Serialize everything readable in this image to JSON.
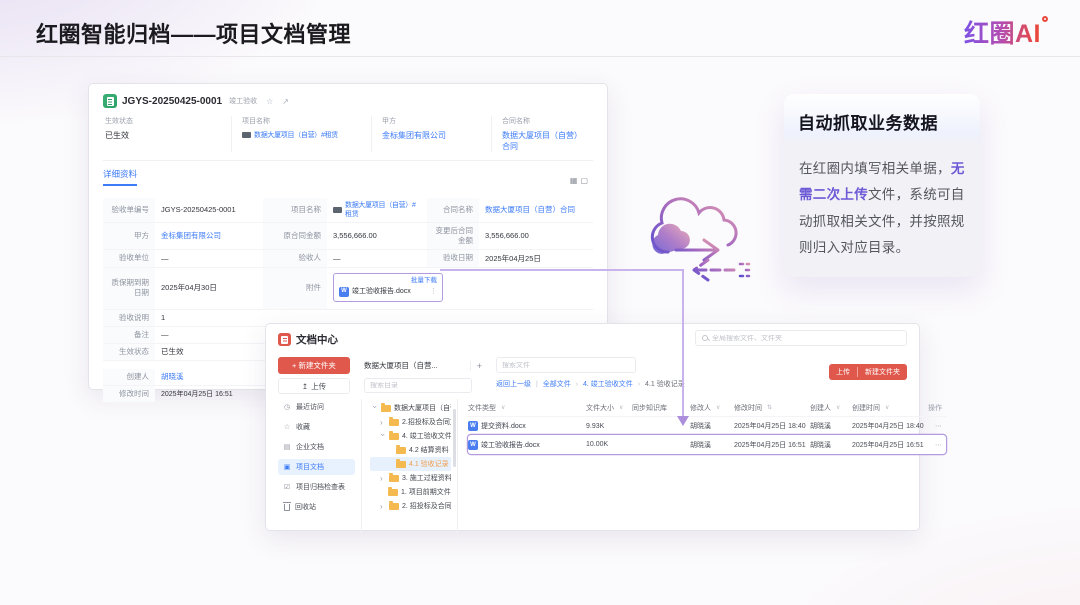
{
  "slide": {
    "title": "红圈智能归档——项目文档管理",
    "logo": "红圈AI"
  },
  "icons": {
    "star": "☆",
    "external": "↗",
    "grid_filled": "▦",
    "grid_empty": "▢",
    "caret": "∨",
    "sort": "⇅",
    "kebab": "⋮",
    "more": "⋯",
    "plus": "+",
    "upload": "↥",
    "chevron": "›",
    "clock": "◷",
    "fav": "☆",
    "corp": "▤",
    "proj": "▣",
    "check": "☑",
    "word": "W",
    "pipe": "|",
    "new_folder_plus": "+"
  },
  "detail_window": {
    "doc_id": "JGYS-20250425-0001",
    "doc_type": "竣工验收",
    "summary": [
      {
        "label": "生效状态",
        "value": "已生效"
      },
      {
        "label": "项目名称",
        "value": "数据大厦项目（自营）#租赁"
      },
      {
        "label": "甲方",
        "value": "金标集团有限公司"
      },
      {
        "label": "合同名称",
        "value": "数据大厦项目（自营）合同"
      }
    ],
    "tab": "详细资料",
    "rows": {
      "r1": {
        "l1": "验收单编号",
        "v1": "JGYS-20250425-0001",
        "l2": "项目名称",
        "v2": "数据大厦项目（自营）#租赁",
        "l3": "合同名称",
        "v3": "数据大厦项目（自营）合同"
      },
      "r2": {
        "l1": "甲方",
        "v1": "金标集团有限公司",
        "l2": "原合同金额",
        "v2": "3,556,666.00",
        "l3": "变更后合同金额",
        "v3": "3,556,666.00"
      },
      "r3": {
        "l1": "验收单位",
        "v1": "—",
        "l2": "验收人",
        "v2": "—",
        "l3": "验收日期",
        "v3": "2025年04月25日"
      },
      "r4": {
        "l1": "质保期到期日期",
        "v1": "2025年04月30日",
        "l2": "附件"
      },
      "r5": {
        "l1": "验收说明",
        "v1": "1"
      },
      "r6": {
        "l1": "备注",
        "v1": "—"
      },
      "r7": {
        "l1": "生效状态",
        "v1": "已生效"
      },
      "r8": {
        "l1": "创建人",
        "v1": "胡晓溪"
      },
      "r9": {
        "l1": "修改时间",
        "v1": "2025年04月25日 16:51"
      }
    },
    "attachment": {
      "download": "批量下载",
      "filename": "竣工验收报告.docx"
    }
  },
  "doc_center": {
    "title": "文档中心",
    "global_search_placeholder": "全局搜索文件、文件夹",
    "new_folder_button": "新建文件夹",
    "upload_button": "上传",
    "project_selector": "数据大厦项目（自营...",
    "search_file_placeholder": "搜索文件",
    "search_dir_placeholder": "搜索目录",
    "breadcrumb": [
      "返回上一级",
      "全部文件",
      "4. 竣工验收文件",
      "4.1 验收记录"
    ],
    "topright_upload": "上传",
    "topright_new_folder": "新建文件夹",
    "sidebar": [
      "最近访问",
      "收藏",
      "企业文档",
      "项目文档",
      "项目归档检查表",
      "回收站"
    ],
    "tree": [
      "数据大厦项目（自营...",
      "2.招投标及合同文件",
      "4. 竣工验收文件",
      "4.2 结算资料",
      "4.1 验收记录",
      "3. 施工过程资料",
      "1. 项目前期文件",
      "2. 招投标及合同..."
    ],
    "table": {
      "headers": [
        "文件类型",
        "文件大小",
        "同步知识库",
        "修改人",
        "修改时间",
        "创建人",
        "创建时间",
        "操作"
      ],
      "rows": [
        {
          "name": "提交资料.docx",
          "size": "9.93K",
          "modifier": "胡晓溪",
          "mtime": "2025年04月25日 18:40",
          "creator": "胡晓溪",
          "ctime": "2025年04月25日 18:40"
        },
        {
          "name": "竣工验收报告.docx",
          "size": "10.00K",
          "modifier": "胡晓溪",
          "mtime": "2025年04月25日 16:51",
          "creator": "胡晓溪",
          "ctime": "2025年04月25日 16:51"
        }
      ]
    }
  },
  "callout": {
    "title": "自动抓取业务数据",
    "body_pre": "在红圈内填写相关单据，",
    "body_highlight": "无需二次上传",
    "body_post": "文件，系统可自动抓取相关文件，并按照规则归入对应目录。"
  }
}
